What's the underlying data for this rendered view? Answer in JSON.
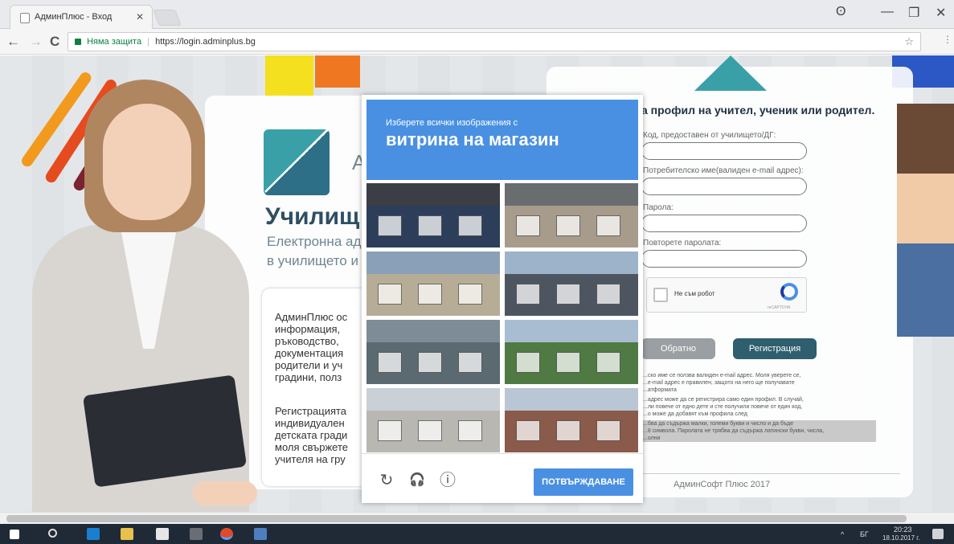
{
  "browser": {
    "tab_title": "АдминПлюс - Вход",
    "tab_close": "✕",
    "window_controls": {
      "profile": "ʘ",
      "minimize": "—",
      "maximize": "❐",
      "close": "✕"
    },
    "nav": {
      "back": "←",
      "forward": "→",
      "reload": "C"
    },
    "security_label": "Няма защита",
    "url": "https://login.adminplus.bg",
    "star": "☆",
    "menu": "⋮"
  },
  "page": {
    "brand_letter": "A",
    "school_title": "Училищ",
    "subtitle_line1": "Електронна ад",
    "subtitle_line2": "в училището и",
    "info_lines": [
      "АдминПлюс ос",
      "информация, ",
      "ръководство, ",
      "документация",
      "родители и уч",
      "градини, полз"
    ],
    "info_lines2": [
      "Регистрацията",
      "индивидуален",
      "детската гради",
      "моля свържете",
      "учителя на гру"
    ],
    "form_title": "а профил на учител, ученик или родител.",
    "labels": [
      "Код, предоставен от училището/ДГ:",
      "Потребителско име(валиден e-mail адрес):",
      "Парола:",
      "Повторете паролата:"
    ],
    "captcha_checkbox_label": "Не съм робот",
    "captcha_brand": "reCAPTCHA",
    "back_button": "Обратно",
    "register_button": "Регистрация",
    "notes": [
      "...ско име се ползва валиден e-mail адрес. Моля уверете се,",
      "...e-mail адрес е правилен, защото на него ще получавате",
      "...атформата",
      "...адрес може да се регистрира само един профил. В случай,",
      "...ли повече от едно дете и сте получили повече от един код,",
      "...о може да добавят към профила след",
      "...бва да съдържа малки, големи букви и число и да бъде",
      "...8 символа. Паролата не трябва да съдържа латински букви, числа,",
      "...олни"
    ],
    "footer": "АдминСофт Плюс 2017"
  },
  "captcha_modal": {
    "instruction": "Изберете всички изображения с",
    "keyword": "витрина на магазин",
    "tiles": [
      {
        "name": "tile-1",
        "sky": "#3b3e44",
        "bld": "#2c3e5a"
      },
      {
        "name": "tile-2",
        "sky": "#6a6d70",
        "bld": "#a79c8c"
      },
      {
        "name": "tile-3",
        "sky": "#8aa0b8",
        "bld": "#b7ac96"
      },
      {
        "name": "tile-4",
        "sky": "#9db3c9",
        "bld": "#4d5660"
      },
      {
        "name": "tile-5",
        "sky": "#7d8c96",
        "bld": "#5b6a70"
      },
      {
        "name": "tile-6",
        "sky": "#a8bdd1",
        "bld": "#4f7a43"
      },
      {
        "name": "tile-7",
        "sky": "#c9d0d6",
        "bld": "#b9b7b2"
      },
      {
        "name": "tile-8",
        "sky": "#b9c6d3",
        "bld": "#8a5a4a"
      }
    ],
    "reload_icon": "↻",
    "audio_icon": "🎧",
    "info_icon": "ⓘ",
    "verify_label": "ПОТВЪРЖДАВАНЕ"
  },
  "taskbar": {
    "language": "БГ",
    "time": "20:23",
    "date": "18.10.2017 г.",
    "tray_arrow": "^"
  },
  "colors": {
    "captcha_blue": "#4a90e2",
    "register_teal": "#2f5e6e",
    "back_gray": "#9a9fa3",
    "taskbar": "#1f2a36"
  }
}
